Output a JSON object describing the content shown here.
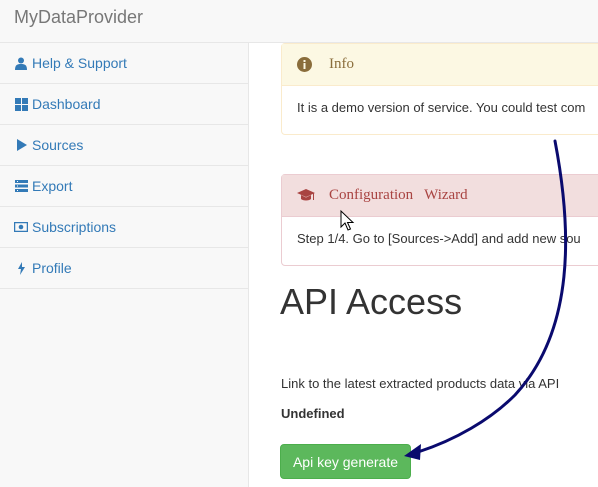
{
  "brand": "MyDataProvider",
  "sidebar": {
    "items": [
      {
        "label": "Help & Support",
        "icon": "user-icon"
      },
      {
        "label": "Dashboard",
        "icon": "dashboard-icon"
      },
      {
        "label": "Sources",
        "icon": "play-icon"
      },
      {
        "label": "Export",
        "icon": "list-icon"
      },
      {
        "label": "Subscriptions",
        "icon": "money-icon"
      },
      {
        "label": "Profile",
        "icon": "bolt-icon"
      }
    ]
  },
  "info_panel": {
    "title": "Info",
    "body": "It is a demo version of service. You could test com"
  },
  "wizard_panel": {
    "title": "Configuration   Wizard",
    "body": "Step 1/4. Go to [Sources->Add] and add new sou"
  },
  "main": {
    "title": "API Access",
    "link_text": "Link to the latest extracted products data via API",
    "api_value": "Undefined",
    "generate_button": "Api key generate"
  },
  "colors": {
    "link": "#337ab7",
    "success": "#5cb85c",
    "annotation_arrow": "#0a0a6e"
  }
}
